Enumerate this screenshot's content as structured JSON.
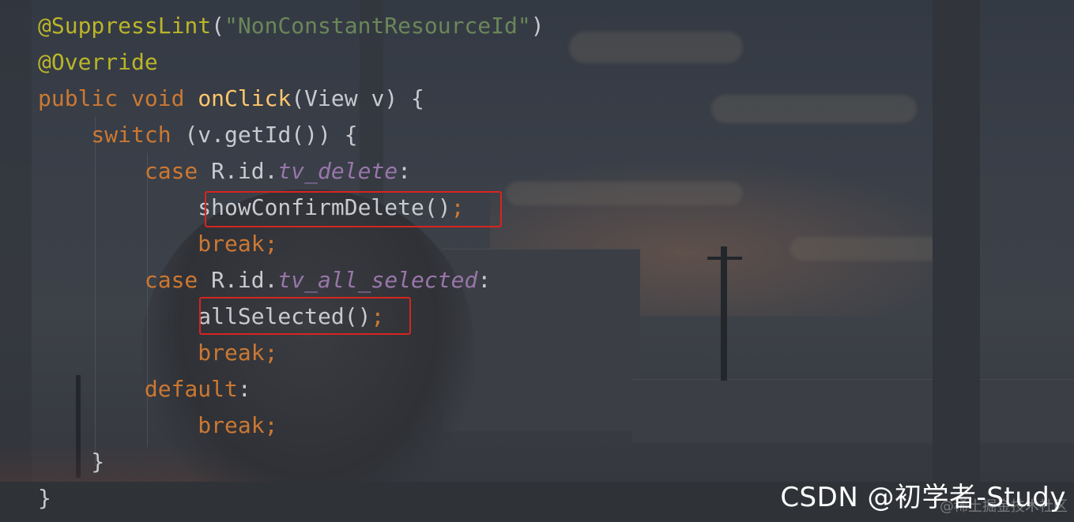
{
  "code": {
    "lines": [
      [
        {
          "t": "@SuppressLint",
          "c": "annotation"
        },
        {
          "t": "(",
          "c": "plain"
        },
        {
          "t": "\"NonConstantResourceId\"",
          "c": "string"
        },
        {
          "t": ")",
          "c": "plain"
        }
      ],
      [
        {
          "t": "@Override",
          "c": "annotation"
        }
      ],
      [
        {
          "t": "public ",
          "c": "keyword"
        },
        {
          "t": "void ",
          "c": "keyword"
        },
        {
          "t": "onClick",
          "c": "method"
        },
        {
          "t": "(View v) {",
          "c": "plain"
        }
      ],
      [
        {
          "t": "    switch ",
          "c": "keyword"
        },
        {
          "t": "(v.getId()) {",
          "c": "plain"
        }
      ],
      [
        {
          "t": "        case ",
          "c": "keyword"
        },
        {
          "t": "R.id.",
          "c": "plain"
        },
        {
          "t": "tv_delete",
          "c": "field"
        },
        {
          "t": ":",
          "c": "plain"
        }
      ],
      [
        {
          "t": "            showConfirmDelete()",
          "c": "plain"
        },
        {
          "t": ";",
          "c": "keyword"
        }
      ],
      [
        {
          "t": "            break",
          "c": "keyword"
        },
        {
          "t": ";",
          "c": "keyword"
        }
      ],
      [
        {
          "t": "        case ",
          "c": "keyword"
        },
        {
          "t": "R.id.",
          "c": "plain"
        },
        {
          "t": "tv_all_selected",
          "c": "field"
        },
        {
          "t": ":",
          "c": "plain"
        }
      ],
      [
        {
          "t": "            allSelected()",
          "c": "plain"
        },
        {
          "t": ";",
          "c": "keyword"
        }
      ],
      [
        {
          "t": "            break",
          "c": "keyword"
        },
        {
          "t": ";",
          "c": "keyword"
        }
      ],
      [
        {
          "t": "        default",
          "c": "keyword"
        },
        {
          "t": ":",
          "c": "plain"
        }
      ],
      [
        {
          "t": "            break",
          "c": "keyword"
        },
        {
          "t": ";",
          "c": "keyword"
        }
      ],
      [
        {
          "t": "    }",
          "c": "plain"
        }
      ],
      [
        {
          "t": "}",
          "c": "plain"
        }
      ]
    ],
    "highlighted_calls": [
      "showConfirmDelete();",
      "allSelected();"
    ]
  },
  "watermark": {
    "label": "CSDN @初学者-Study",
    "faint_label": "@稀土掘金技术社区"
  },
  "colors": {
    "annotation": "#bbb529",
    "string": "#6a8759",
    "keyword": "#cc7832",
    "method": "#ffc66d",
    "field": "#9876aa",
    "plain": "#c8cad0",
    "highlight_border": "#d6251f"
  }
}
